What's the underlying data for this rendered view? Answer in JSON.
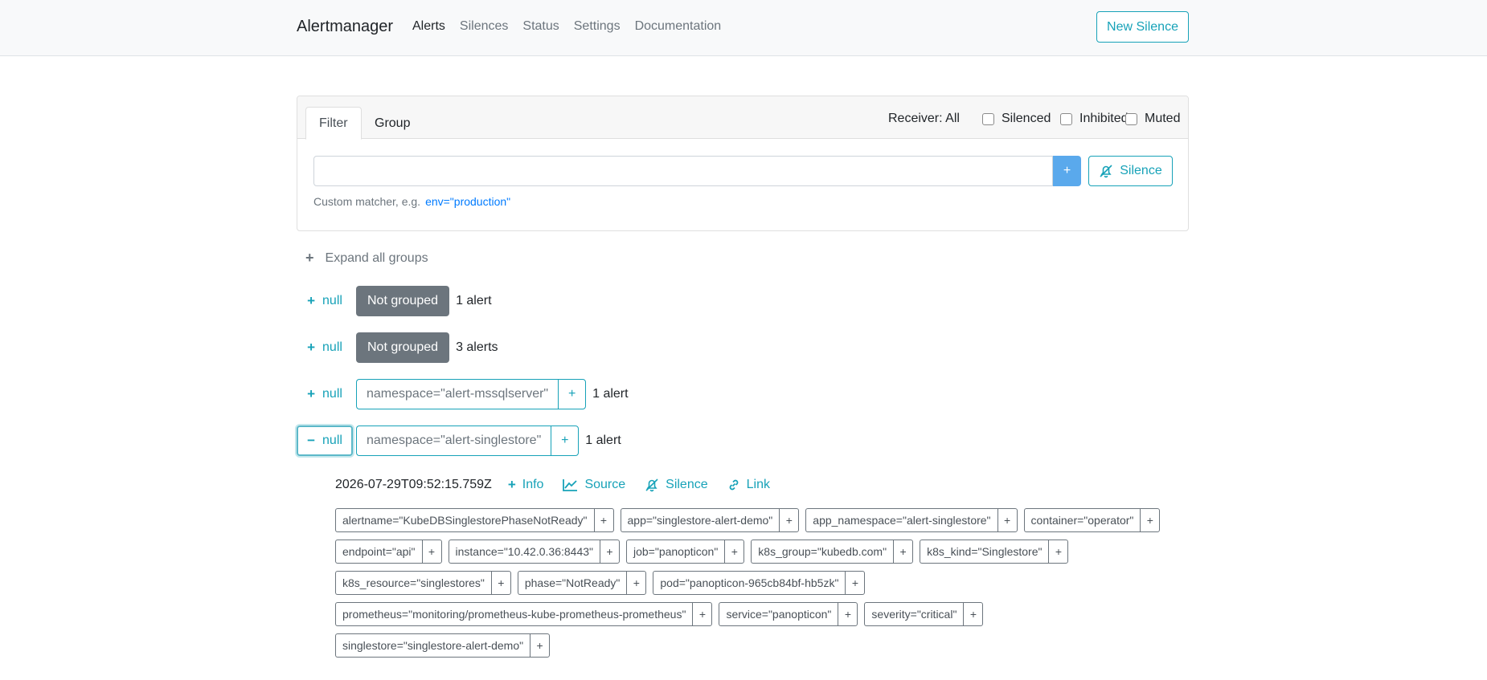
{
  "navbar": {
    "brand": "Alertmanager",
    "items": [
      {
        "label": "Alerts",
        "active": true
      },
      {
        "label": "Silences",
        "active": false
      },
      {
        "label": "Status",
        "active": false
      },
      {
        "label": "Settings",
        "active": false
      },
      {
        "label": "Documentation",
        "active": false
      }
    ],
    "new_silence_label": "New Silence"
  },
  "filter_card": {
    "tabs": [
      {
        "label": "Filter",
        "active": true
      },
      {
        "label": "Group",
        "active": false
      }
    ],
    "receiver_label": "Receiver: All",
    "checkboxes": [
      {
        "label": "Silenced",
        "checked": false
      },
      {
        "label": "Inhibited",
        "checked": false
      },
      {
        "label": "Muted",
        "checked": false
      }
    ],
    "filter_input_value": "",
    "add_button_label": "+",
    "silence_button_label": "Silence",
    "hint_text": "Custom matcher, e.g.",
    "hint_example": "env=\"production\""
  },
  "groups": {
    "expand_all_label": "Expand all groups",
    "rows": [
      {
        "toggle_sign": "+",
        "toggle_label": "null",
        "kind": "not-grouped",
        "label": "Not grouped",
        "count": "1 alert"
      },
      {
        "toggle_sign": "+",
        "toggle_label": "null",
        "kind": "not-grouped",
        "label": "Not grouped",
        "count": "3 alerts"
      },
      {
        "toggle_sign": "+",
        "toggle_label": "null",
        "kind": "label",
        "label": "namespace=\"alert-mssqlserver\"",
        "add": "+",
        "count": "1 alert"
      },
      {
        "toggle_sign": "−",
        "toggle_label": "null",
        "kind": "label",
        "label": "namespace=\"alert-singlestore\"",
        "add": "+",
        "count": "1 alert"
      }
    ]
  },
  "alert": {
    "timestamp": "2026-07-29T09:52:15.759Z",
    "actions": {
      "info": "Info",
      "source": "Source",
      "silence": "Silence",
      "link": "Link"
    },
    "label_add": "+",
    "label_rows": [
      [
        "alertname=\"KubeDBSinglestorePhaseNotReady\"",
        "app=\"singlestore-alert-demo\"",
        "app_namespace=\"alert-singlestore\"",
        "container=\"operator\""
      ],
      [
        "endpoint=\"api\"",
        "instance=\"10.42.0.36:8443\"",
        "job=\"panopticon\"",
        "k8s_group=\"kubedb.com\"",
        "k8s_kind=\"Singlestore\""
      ],
      [
        "k8s_resource=\"singlestores\"",
        "phase=\"NotReady\"",
        "pod=\"panopticon-965cb84bf-hb5zk\""
      ],
      [
        "prometheus=\"monitoring/prometheus-kube-prometheus-prometheus\"",
        "service=\"panopticon\"",
        "severity=\"critical\""
      ],
      [
        "singlestore=\"singlestore-alert-demo\""
      ]
    ]
  }
}
